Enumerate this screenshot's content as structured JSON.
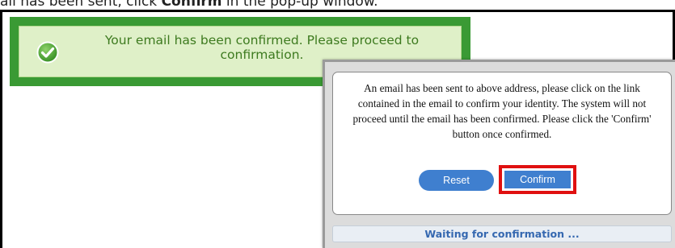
{
  "caption": {
    "prefix": "ail has been sent, click ",
    "bold": "Confirm",
    "suffix": " in the pop-up window."
  },
  "success_banner": {
    "icon": "check-circle-icon",
    "message": "Your email has been confirmed. Please proceed to confirmation.",
    "colors": {
      "border": "#3a9a34",
      "background": "#dff0c8",
      "text": "#3d7a1f"
    }
  },
  "dialog": {
    "message": "An email has been sent to above address, please click on the link contained in the email to confirm your identity. The system will not proceed until the email has been confirmed. Please click the 'Confirm' button once confirmed.",
    "reset_label": "Reset",
    "confirm_label": "Confirm",
    "status_text": "Waiting for confirmation ...",
    "colors": {
      "button": "#3f7fcf",
      "highlight": "#e01010",
      "status_text": "#3568b0"
    }
  }
}
